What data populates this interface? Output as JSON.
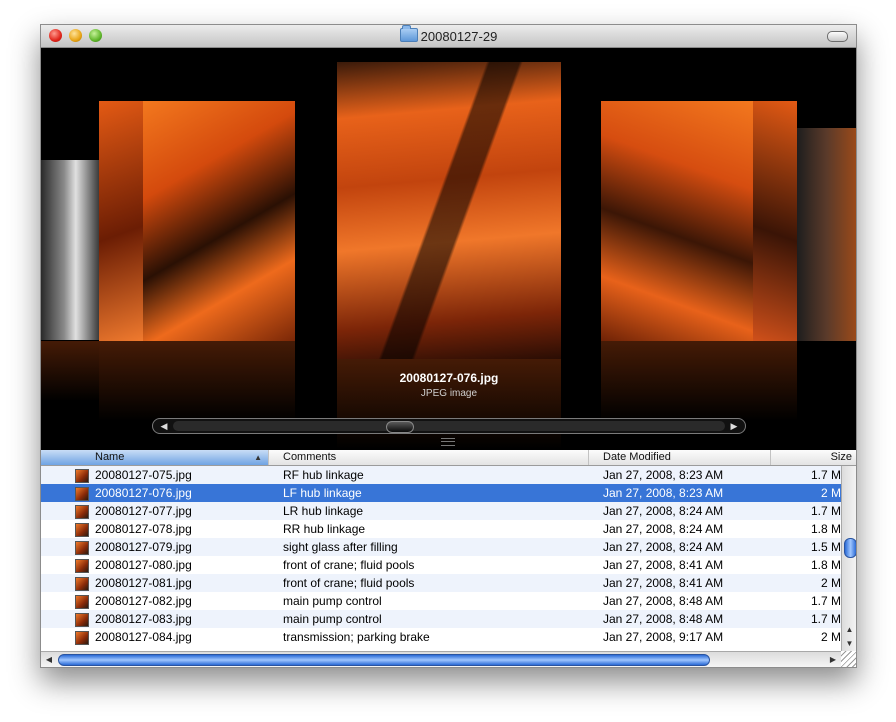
{
  "window": {
    "title": "20080127-29",
    "folder_icon": "folder-icon"
  },
  "coverflow": {
    "selected_filename": "20080127-076.jpg",
    "selected_kind": "JPEG image",
    "scroll_left_arrow": "◀",
    "scroll_right_arrow": "▶"
  },
  "list": {
    "columns": {
      "name": "Name",
      "comments": "Comments",
      "date": "Date Modified",
      "size": "Size"
    },
    "sort_indicator": "▲",
    "rows": [
      {
        "name": "20080127-075.jpg",
        "comment": "RF hub linkage",
        "date": "Jan 27, 2008, 8:23 AM",
        "size": "1.7 M"
      },
      {
        "name": "20080127-076.jpg",
        "comment": "LF hub linkage",
        "date": "Jan 27, 2008, 8:23 AM",
        "size": "2 M"
      },
      {
        "name": "20080127-077.jpg",
        "comment": "LR hub linkage",
        "date": "Jan 27, 2008, 8:24 AM",
        "size": "1.7 M"
      },
      {
        "name": "20080127-078.jpg",
        "comment": "RR hub linkage",
        "date": "Jan 27, 2008, 8:24 AM",
        "size": "1.8 M"
      },
      {
        "name": "20080127-079.jpg",
        "comment": "sight glass after filling",
        "date": "Jan 27, 2008, 8:24 AM",
        "size": "1.5 M"
      },
      {
        "name": "20080127-080.jpg",
        "comment": "front of crane; fluid pools",
        "date": "Jan 27, 2008, 8:41 AM",
        "size": "1.8 M"
      },
      {
        "name": "20080127-081.jpg",
        "comment": "front of crane; fluid pools",
        "date": "Jan 27, 2008, 8:41 AM",
        "size": "2 M"
      },
      {
        "name": "20080127-082.jpg",
        "comment": "main pump control",
        "date": "Jan 27, 2008, 8:48 AM",
        "size": "1.7 M"
      },
      {
        "name": "20080127-083.jpg",
        "comment": "main pump control",
        "date": "Jan 27, 2008, 8:48 AM",
        "size": "1.7 M"
      },
      {
        "name": "20080127-084.jpg",
        "comment": "transmission; parking brake",
        "date": "Jan 27, 2008, 9:17 AM",
        "size": "2 M"
      }
    ],
    "selected_index": 1
  },
  "scroll": {
    "up_arrow": "▲",
    "down_arrow": "▼",
    "left_arrow": "◀",
    "right_arrow": "▶"
  }
}
